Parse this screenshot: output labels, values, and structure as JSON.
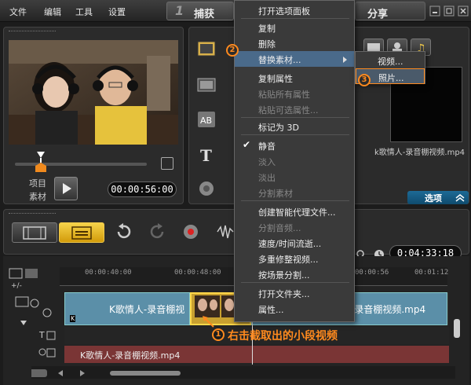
{
  "menubar": {
    "items": [
      "文件",
      "编辑",
      "工具",
      "设置"
    ],
    "step_number": "1",
    "step_label": "捕获",
    "share_label": "分享"
  },
  "player": {
    "project_label": "项目",
    "clip_label": "素材",
    "timecode": "00:00:56:00"
  },
  "library": {
    "filename": "k歌情人-录音棚视频.mp4",
    "options_label": "选项"
  },
  "timeline": {
    "duration": "0:04:33:18",
    "ruler_ticks": [
      "00:00:40:00",
      "00:00:48:00",
      "00:00:56",
      "00:01:12"
    ],
    "clip_title_left": "K歌情人-录音棚视",
    "clip_title_right": "-录音棚视频.mp4",
    "audio_title": "K歌情人-录音棚视频.mp4",
    "annotation": "右击截取出的小段视频",
    "badge_1": "1"
  },
  "context_menu": {
    "items": [
      {
        "label": "打开选项面板",
        "enabled": true
      },
      {
        "label": "复制",
        "enabled": true
      },
      {
        "label": "删除",
        "enabled": true
      },
      {
        "label": "替换素材...",
        "enabled": true,
        "submenu": true
      },
      {
        "label": "复制属性",
        "enabled": true
      },
      {
        "label": "粘贴所有属性",
        "enabled": false
      },
      {
        "label": "粘贴可选属性...",
        "enabled": false
      },
      {
        "label": "标记为 3D",
        "enabled": true
      },
      {
        "label": "静音",
        "enabled": true,
        "checked": true
      },
      {
        "label": "淡入",
        "enabled": false
      },
      {
        "label": "淡出",
        "enabled": false
      },
      {
        "label": "分割素材",
        "enabled": false
      },
      {
        "label": "创建智能代理文件...",
        "enabled": true
      },
      {
        "label": "分割音频...",
        "enabled": false
      },
      {
        "label": "速度/时间流逝...",
        "enabled": true
      },
      {
        "label": "多重修整视频...",
        "enabled": true
      },
      {
        "label": "按场景分割...",
        "enabled": true
      },
      {
        "label": "打开文件夹...",
        "enabled": true
      },
      {
        "label": "属性...",
        "enabled": true
      }
    ],
    "badge_2": "2",
    "submenu": {
      "video_label": "视频...",
      "photo_label": "照片...",
      "badge_3": "3"
    }
  },
  "colors": {
    "accent_orange": "#ff8a1e",
    "clip_blue": "#5b8fa8",
    "clip_selected": "#d6b030",
    "audio_track": "#7a3535"
  }
}
